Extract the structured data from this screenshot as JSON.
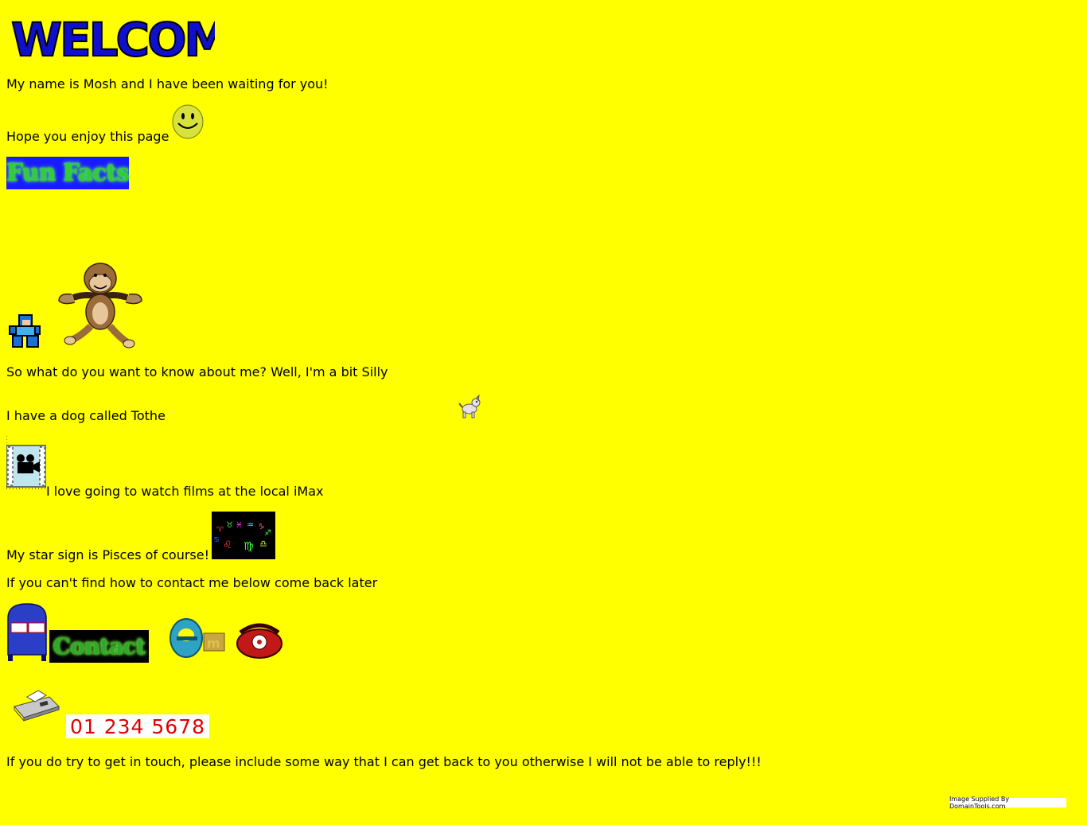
{
  "header": {
    "logo_text": "WELCOME!"
  },
  "intro": {
    "line1": "My name is Mosh and I have been waiting for you!",
    "line2": "Hope you enjoy this page"
  },
  "banner": {
    "fun_facts_label": "Fun Facts"
  },
  "facts": {
    "silly": "So what do you want to know about me? Well, I'm a bit Silly",
    "dog": "I have a dog called Tothe",
    "films": "I love going to watch films at the local iMax",
    "star_sign": "My star sign is Pisces of course!",
    "contact_note": "If you can't find how to contact me below come back later"
  },
  "contact": {
    "label": "Contact",
    "phone_number": "01 234 5678",
    "reply_note": "If you do try to get in touch, please include some way that I can get back to you otherwise I will not be able to reply!!!"
  },
  "footer": {
    "supplied_by": "Image Supplied By DomainTools.com"
  },
  "icons": [
    "smiley-icon",
    "megaman-icon",
    "monkey-icon",
    "dog-icon",
    "film-camera-icon",
    "zodiac-icon",
    "mailbox-icon",
    "email-icon",
    "telephone-icon",
    "fax-icon"
  ],
  "colors": {
    "background": "#ffff00",
    "welcome_text": "#1010cc",
    "fun_facts_bg": "#1a1aff",
    "contact_bg": "#000000",
    "phone_number_text": "#e00000"
  }
}
